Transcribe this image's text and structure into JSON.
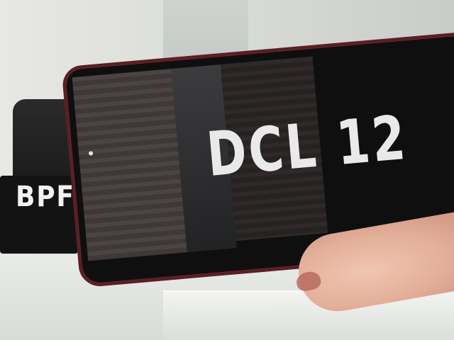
{
  "scene": {
    "description_tag": "photo",
    "plate_text": "DCL 12",
    "background_text": "BPF",
    "colors": {
      "plate_background": "#100f10",
      "plate_border": "#5a1f24",
      "text": "#e9e9e9",
      "skin": "#e3af99"
    }
  }
}
